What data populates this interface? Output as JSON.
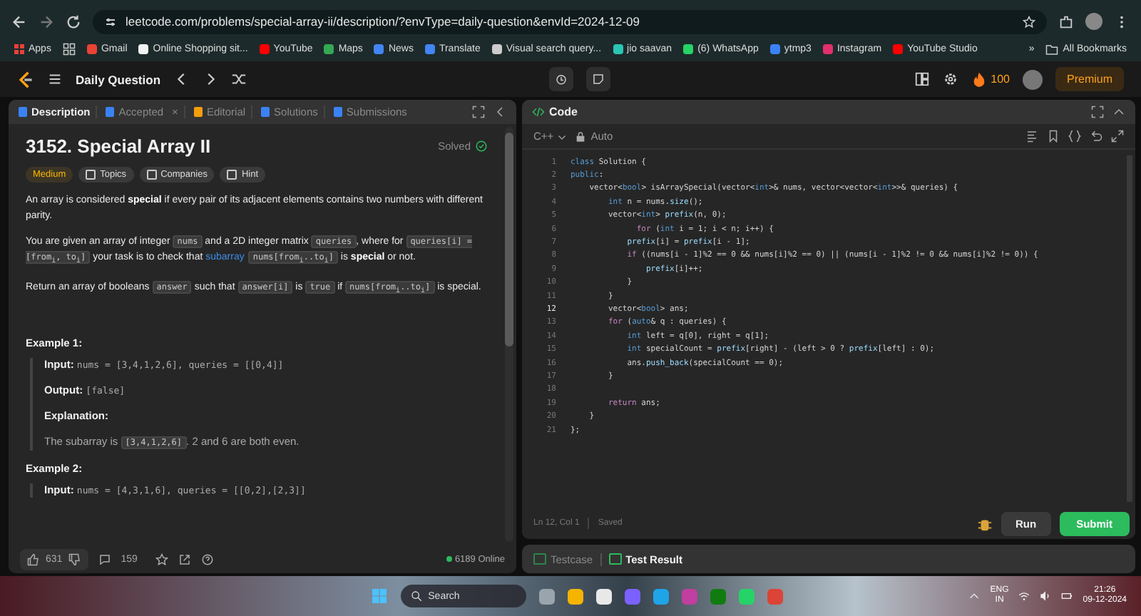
{
  "browser": {
    "url": "leetcode.com/problems/special-array-ii/description/?envType=daily-question&envId=2024-12-09",
    "apps": "Apps",
    "bookmarks": [
      {
        "label": "Gmail",
        "color": "#ea4335"
      },
      {
        "label": "Online Shopping sit...",
        "color": "#f2f2f2"
      },
      {
        "label": "YouTube",
        "color": "#ff0000"
      },
      {
        "label": "Maps",
        "color": "#34a853"
      },
      {
        "label": "News",
        "color": "#4285f4"
      },
      {
        "label": "Translate",
        "color": "#4285f4"
      },
      {
        "label": "Visual search query...",
        "color": "#cccccc"
      },
      {
        "label": "jio saavan",
        "color": "#2bc5b4"
      },
      {
        "label": "(6) WhatsApp",
        "color": "#25d366"
      },
      {
        "label": "ytmp3",
        "color": "#3b82f6"
      },
      {
        "label": "Instagram",
        "color": "#e1306c"
      },
      {
        "label": "YouTube Studio",
        "color": "#ff0000"
      }
    ],
    "overflow": "»",
    "all_bookmarks": "All Bookmarks"
  },
  "nav": {
    "title": "Daily Question",
    "streak": "100",
    "premium": "Premium"
  },
  "description": {
    "tabs": [
      {
        "label": "Description",
        "selected": true,
        "color": "#3b82f6"
      },
      {
        "label": "Accepted",
        "selected": false,
        "color": "#3b82f6",
        "close": "×"
      },
      {
        "label": "Editorial",
        "selected": false,
        "color": "#f59e0b"
      },
      {
        "label": "Solutions",
        "selected": false,
        "color": "#3b82f6"
      },
      {
        "label": "Submissions",
        "selected": false,
        "color": "#3b82f6"
      }
    ],
    "title": "3152. Special Array II",
    "status": "Solved",
    "difficulty": "Medium",
    "tags": [
      "Topics",
      "Companies",
      "Hint"
    ],
    "paragraphs": [
      [
        {
          "kind": "text",
          "text": "An array is considered **special** if every pair of its adjacent elements contains two numbers with different parity."
        }
      ],
      [
        {
          "kind": "text",
          "text": "You are given an array of integer "
        },
        {
          "kind": "code",
          "text": "nums"
        },
        {
          "kind": "text",
          "text": " and a 2D integer matrix "
        },
        {
          "kind": "code",
          "text": "queries"
        },
        {
          "kind": "text",
          "text": ", where for "
        },
        {
          "kind": "code",
          "text": "queries[i] = [from$_{i}$, to$_{i}$]"
        },
        {
          "kind": "text",
          "text": " your task is to check that "
        },
        {
          "kind": "link",
          "text": "subarray"
        },
        {
          "kind": "code",
          "text": "nums[from$_{i}$..to$_{i}$]"
        },
        {
          "kind": "text",
          "text": " is **special** or not."
        }
      ],
      [
        {
          "kind": "text",
          "text": "Return an array of booleans "
        },
        {
          "kind": "code",
          "text": "answer"
        },
        {
          "kind": "text",
          "text": " such that "
        },
        {
          "kind": "code",
          "text": "answer[i]"
        },
        {
          "kind": "text",
          "text": " is "
        },
        {
          "kind": "code",
          "text": "true"
        },
        {
          "kind": "text",
          "text": " if "
        },
        {
          "kind": "code",
          "text": "nums[from$_{i}$..to$_{i}$]"
        },
        {
          "kind": "text",
          "text": " is special."
        }
      ]
    ],
    "examples": [
      {
        "heading": "Example 1:",
        "rows": [
          {
            "kind": "field",
            "label": "Input:",
            "value": "nums = [3,4,1,2,6], queries = [[0,4]]"
          },
          {
            "kind": "field",
            "label": "Output:",
            "value": "[false]"
          },
          {
            "kind": "label",
            "label": "Explanation:"
          },
          {
            "kind": "text",
            "parts": [
              {
                "kind": "text",
                "text": "The subarray is "
              },
              {
                "kind": "code",
                "text": "[3,4,1,2,6]"
              },
              {
                "kind": "text",
                "text": ". 2 and 6 are both even."
              }
            ]
          }
        ]
      },
      {
        "heading": "Example 2:",
        "rows": [
          {
            "kind": "field",
            "label": "Input:",
            "value": "nums = [4,3,1,6], queries = [[0,2],[2,3]]"
          }
        ]
      }
    ],
    "likes": "631",
    "comments": "159",
    "online": "6189 Online"
  },
  "code": {
    "title": "Code",
    "language": "C++",
    "mode": "Auto",
    "lines": [
      {
        "number": "1",
        "current": false,
        "tokens": [
          {
            "kind": "keyword",
            "text": "class"
          },
          {
            "kind": "plain",
            "text": " Solution {"
          }
        ]
      },
      {
        "number": "2",
        "current": false,
        "tokens": [
          {
            "kind": "keyword",
            "text": "public"
          },
          {
            "kind": "plain",
            "text": ":"
          }
        ]
      },
      {
        "number": "3",
        "current": false,
        "tokens": [
          {
            "kind": "plain",
            "text": "    vector<"
          },
          {
            "kind": "keyword",
            "text": "bool"
          },
          {
            "kind": "plain",
            "text": "> isArraySpecial(vector<"
          },
          {
            "kind": "keyword",
            "text": "int"
          },
          {
            "kind": "plain",
            "text": ">& nums, vector<vector<"
          },
          {
            "kind": "keyword",
            "text": "int"
          },
          {
            "kind": "plain",
            "text": ">>& queries) {"
          }
        ]
      },
      {
        "number": "4",
        "current": false,
        "tokens": [
          {
            "kind": "keyword",
            "text": "        int"
          },
          {
            "kind": "plain",
            "text": " n = nums."
          },
          {
            "kind": "function",
            "text": "size"
          },
          {
            "kind": "plain",
            "text": "();"
          }
        ]
      },
      {
        "number": "5",
        "current": false,
        "tokens": [
          {
            "kind": "plain",
            "text": "        vector<"
          },
          {
            "kind": "keyword",
            "text": "int"
          },
          {
            "kind": "plain",
            "text": "> "
          },
          {
            "kind": "function",
            "text": "prefix"
          },
          {
            "kind": "plain",
            "text": "(n, 0);"
          }
        ]
      },
      {
        "number": "6",
        "current": false,
        "tokens": [
          {
            "kind": "control",
            "text": "              for"
          },
          {
            "kind": "plain",
            "text": " ("
          },
          {
            "kind": "keyword",
            "text": "int"
          },
          {
            "kind": "plain",
            "text": " i = 1; i < n; i++) {"
          }
        ]
      },
      {
        "number": "7",
        "current": false,
        "tokens": [
          {
            "kind": "function",
            "text": "            prefix"
          },
          {
            "kind": "plain",
            "text": "[i] = "
          },
          {
            "kind": "function",
            "text": "prefix"
          },
          {
            "kind": "plain",
            "text": "[i - 1];"
          }
        ]
      },
      {
        "number": "8",
        "current": false,
        "tokens": [
          {
            "kind": "control",
            "text": "            if"
          },
          {
            "kind": "plain",
            "text": " ((nums[i - 1]%2 == 0 && nums[i]%2 == 0) || (nums[i - 1]%2 != 0 && nums[i]%2 != 0)) {"
          }
        ]
      },
      {
        "number": "9",
        "current": false,
        "tokens": [
          {
            "kind": "function",
            "text": "                prefix"
          },
          {
            "kind": "plain",
            "text": "[i]++;"
          }
        ]
      },
      {
        "number": "10",
        "current": false,
        "tokens": [
          {
            "kind": "plain",
            "text": "            }"
          }
        ]
      },
      {
        "number": "11",
        "current": false,
        "tokens": [
          {
            "kind": "plain",
            "text": "        }"
          }
        ]
      },
      {
        "number": "12",
        "current": true,
        "tokens": [
          {
            "kind": "plain",
            "text": "        vector<"
          },
          {
            "kind": "keyword",
            "text": "bool"
          },
          {
            "kind": "plain",
            "text": "> ans;"
          }
        ]
      },
      {
        "number": "13",
        "current": false,
        "tokens": [
          {
            "kind": "control",
            "text": "        for"
          },
          {
            "kind": "plain",
            "text": " ("
          },
          {
            "kind": "keyword",
            "text": "auto"
          },
          {
            "kind": "plain",
            "text": "& q : queries) {"
          }
        ]
      },
      {
        "number": "14",
        "current": false,
        "tokens": [
          {
            "kind": "keyword",
            "text": "            int"
          },
          {
            "kind": "plain",
            "text": " left = q[0], right = q[1];"
          }
        ]
      },
      {
        "number": "15",
        "current": false,
        "tokens": [
          {
            "kind": "keyword",
            "text": "            int"
          },
          {
            "kind": "plain",
            "text": " specialCount = "
          },
          {
            "kind": "function",
            "text": "prefix"
          },
          {
            "kind": "plain",
            "text": "[right] - (left > 0 ? "
          },
          {
            "kind": "function",
            "text": "prefix"
          },
          {
            "kind": "plain",
            "text": "[left] : 0);"
          }
        ]
      },
      {
        "number": "16",
        "current": false,
        "tokens": [
          {
            "kind": "plain",
            "text": "            ans."
          },
          {
            "kind": "function",
            "text": "push_back"
          },
          {
            "kind": "plain",
            "text": "(specialCount == 0);"
          }
        ]
      },
      {
        "number": "17",
        "current": false,
        "tokens": [
          {
            "kind": "plain",
            "text": "        }"
          }
        ]
      },
      {
        "number": "18",
        "current": false
      },
      {
        "number": "19",
        "current": false,
        "tokens": [
          {
            "kind": "control",
            "text": "        return"
          },
          {
            "kind": "plain",
            "text": " ans;"
          }
        ]
      },
      {
        "number": "20",
        "current": false,
        "tokens": [
          {
            "kind": "plain",
            "text": "    }"
          }
        ]
      },
      {
        "number": "21",
        "current": false,
        "tokens": [
          {
            "kind": "plain",
            "text": "};"
          }
        ]
      }
    ],
    "cursor": "Ln 12, Col 1",
    "saved": "Saved",
    "run": "Run",
    "submit": "Submit"
  },
  "bottom_tabs": [
    {
      "label": "Testcase",
      "selected": false
    },
    {
      "label": "Test Result",
      "selected": true
    }
  ],
  "taskbar": {
    "search": "Search",
    "apps": [
      {
        "color": "#9aa4ad"
      },
      {
        "color": "#f4b400"
      },
      {
        "color": "#e8e8e8"
      },
      {
        "color": "#7b61ff"
      },
      {
        "color": "#1fa4e8"
      },
      {
        "color": "#c03fa0"
      },
      {
        "color": "#107c10"
      },
      {
        "color": "#25d366"
      },
      {
        "color": "#db4437"
      }
    ],
    "language": "ENG",
    "region": "IN",
    "time": "21:26",
    "date": "09-12-2024"
  }
}
